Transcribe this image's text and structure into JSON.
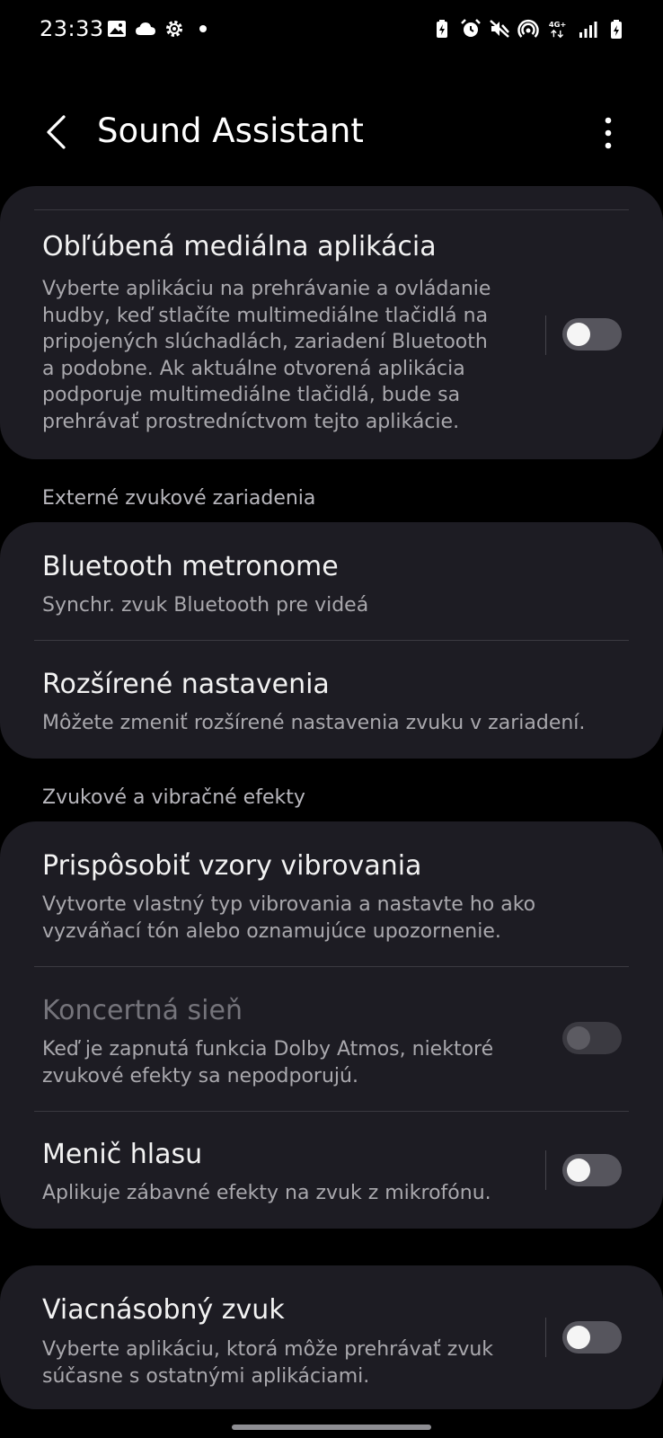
{
  "status_bar": {
    "time": "23:33",
    "left_icons": [
      "gallery-icon",
      "cloud-icon",
      "settings-icon",
      "dot-icon"
    ],
    "right_icons": [
      "battery-saver-icon",
      "alarm-icon",
      "mute-icon",
      "hotspot-icon",
      "4g-icon",
      "signal-icon",
      "battery-icon"
    ],
    "network_label": "4G+"
  },
  "header": {
    "title": "Sound Assistant"
  },
  "media_app": {
    "title": "Obľúbená mediálna aplikácia",
    "description": "Vyberte aplikáciu na prehrávanie a ovládanie hudby, keď stlačíte multimediálne tlačidlá na pripojených slúchadlách, zariadení Bluetooth a podobne. Ak aktuálne otvorená aplikácia podporuje multimediálne tlačidlá, bude sa prehrávať prostredníctvom tejto aplikácie.",
    "toggle_on": false
  },
  "section_external": {
    "label": "Externé zvukové zariadenia"
  },
  "bluetooth": {
    "title": "Bluetooth metronome",
    "subtitle": "Synchr. zvuk Bluetooth pre videá"
  },
  "advanced": {
    "title": "Rozšírené nastavenia",
    "subtitle": "Môžete zmeniť rozšírené nastavenia zvuku v zariadení."
  },
  "section_effects": {
    "label": "Zvukové a vibračné efekty"
  },
  "vibration": {
    "title": "Prispôsobiť vzory vibrovania",
    "subtitle": "Vytvorte vlastný typ vibrovania a nastavte ho ako vyzváňací tón alebo oznamujúce upozornenie."
  },
  "concert": {
    "title": "Koncertná sieň",
    "subtitle": "Keď je zapnutá funkcia Dolby Atmos, niektoré zvukové efekty sa nepodporujú.",
    "toggle_on": false,
    "disabled": true
  },
  "voice_changer": {
    "title": "Menič hlasu",
    "subtitle": "Aplikuje zábavné efekty na zvuk z mikrofónu.",
    "toggle_on": false
  },
  "multi_sound": {
    "title": "Viacnásobný zvuk",
    "subtitle": "Vyberte aplikáciu, ktorá môže prehrávať zvuk súčasne s ostatnými aplikáciami.",
    "toggle_on": false
  },
  "colors": {
    "background": "#000000",
    "card": "#1d1c23",
    "toggle_off_track": "#56555d",
    "text_primary": "#f2f2f2",
    "text_secondary": "#a9a8ad"
  }
}
